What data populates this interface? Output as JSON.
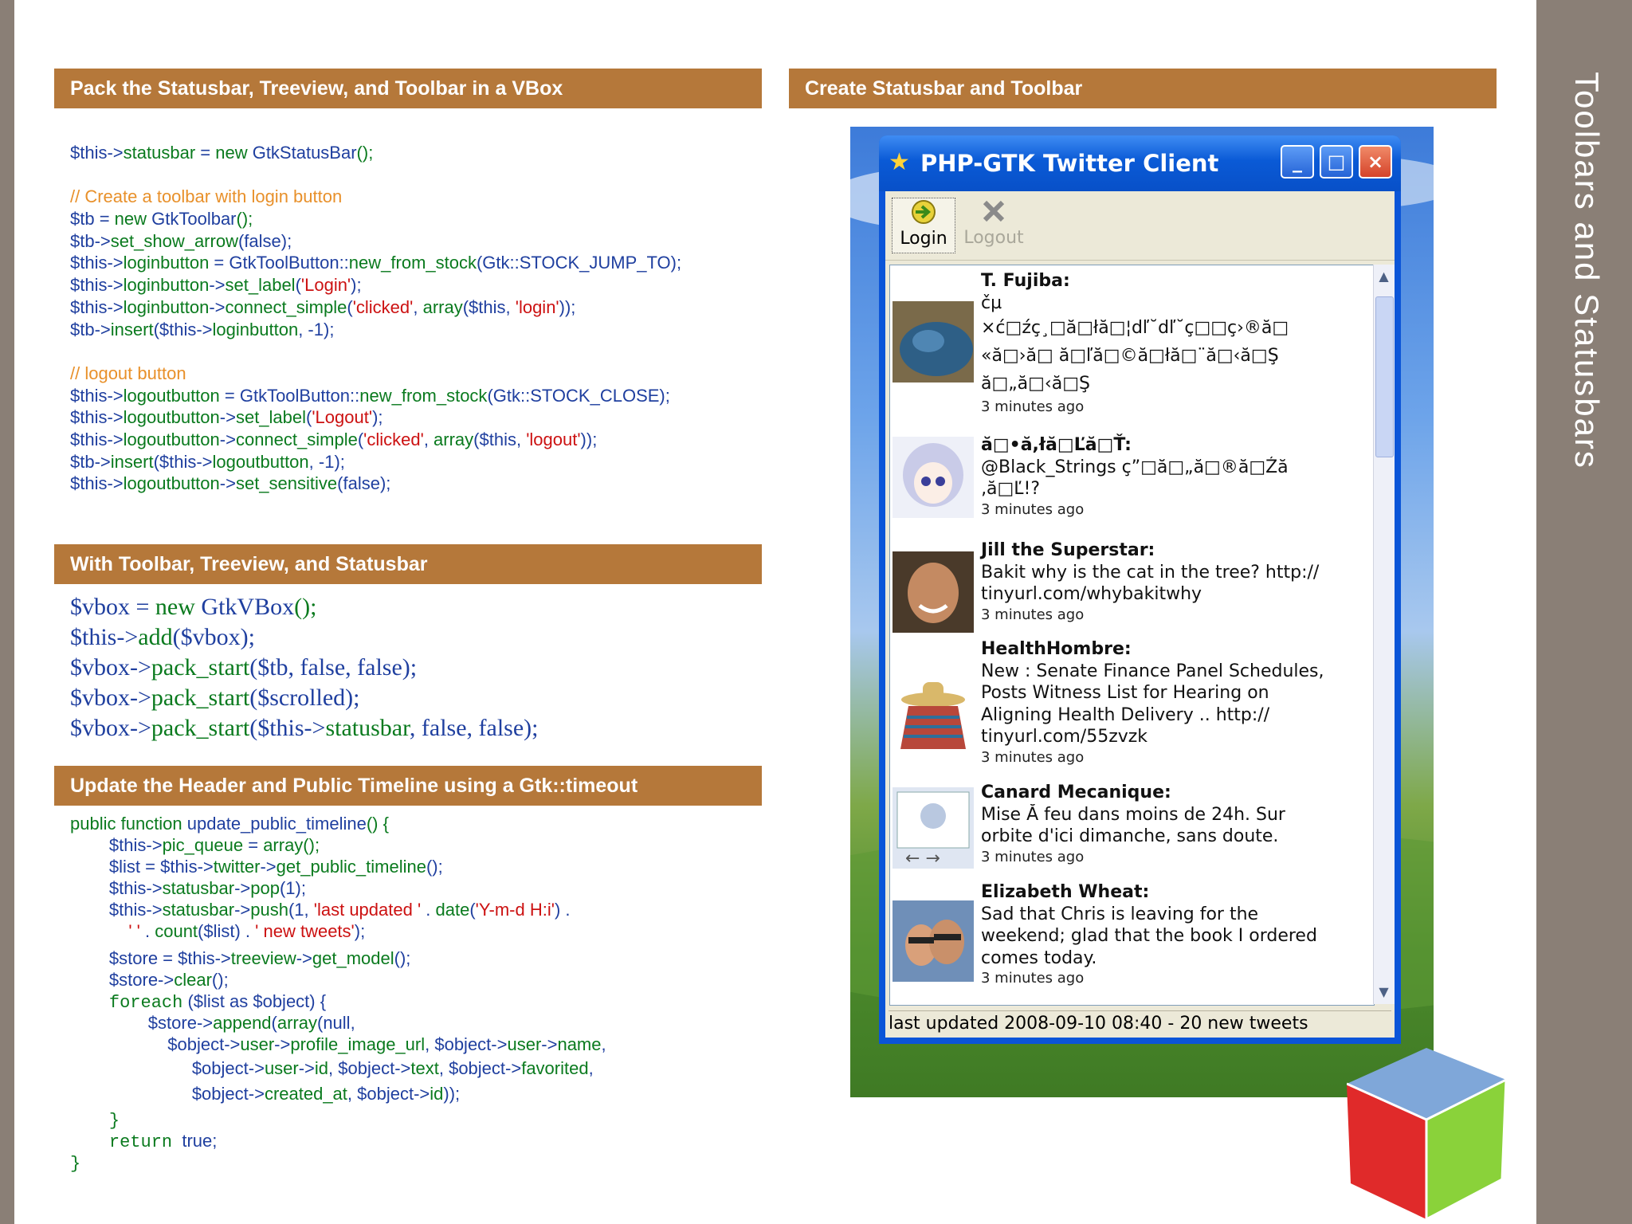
{
  "slide": {
    "title": "Toolbars and Statusbars",
    "sections": {
      "pack": "Pack the Statusbar, Treeview, and Toolbar in a VBox",
      "with": "With Toolbar, Treeview, and Statusbar",
      "update": "Update the Header and Public Timeline using a Gtk::timeout",
      "create": "Create Statusbar and Toolbar"
    }
  },
  "code1": [
    [
      [
        "v",
        "$this->"
      ],
      [
        "f",
        "statusbar"
      ],
      [
        "v",
        " = "
      ],
      [
        "f",
        "new"
      ],
      [
        "v",
        " GtkStatusBar"
      ],
      [
        "f",
        "();"
      ]
    ],
    [],
    [
      [
        "c",
        "// Create a toolbar with login button"
      ]
    ],
    [
      [
        "v",
        "$tb = "
      ],
      [
        "f",
        "new"
      ],
      [
        "v",
        " GtkToolbar"
      ],
      [
        "f",
        "();"
      ]
    ],
    [
      [
        "v",
        "$tb->"
      ],
      [
        "f",
        "set_show_arrow"
      ],
      [
        "v",
        "(false);"
      ]
    ],
    [
      [
        "v",
        "$this->"
      ],
      [
        "f",
        "loginbutton"
      ],
      [
        "v",
        " = GtkToolButton::"
      ],
      [
        "f",
        "new_from_stock"
      ],
      [
        "v",
        "(Gtk::STOCK_JUMP_TO);"
      ]
    ],
    [
      [
        "v",
        "$this->"
      ],
      [
        "f",
        "loginbutton"
      ],
      [
        "v",
        "->"
      ],
      [
        "f",
        "set_label"
      ],
      [
        "v",
        "("
      ],
      [
        "s",
        "'Login'"
      ],
      [
        "v",
        ");"
      ]
    ],
    [
      [
        "v",
        "$this->"
      ],
      [
        "f",
        "loginbutton"
      ],
      [
        "v",
        "->"
      ],
      [
        "f",
        "connect_simple"
      ],
      [
        "v",
        "("
      ],
      [
        "s",
        "'clicked'"
      ],
      [
        "v",
        ", "
      ],
      [
        "f",
        "array"
      ],
      [
        "v",
        "($this, "
      ],
      [
        "s",
        "'login'"
      ],
      [
        "v",
        "));"
      ]
    ],
    [
      [
        "v",
        "$tb->"
      ],
      [
        "f",
        "insert"
      ],
      [
        "v",
        "($this->"
      ],
      [
        "f",
        "loginbutton"
      ],
      [
        "v",
        ", -1);"
      ]
    ],
    [],
    [
      [
        "c",
        "// logout button"
      ]
    ],
    [
      [
        "v",
        "$this->"
      ],
      [
        "f",
        "logoutbutton"
      ],
      [
        "v",
        " = GtkToolButton::"
      ],
      [
        "f",
        "new_from_stock"
      ],
      [
        "v",
        "(Gtk::STOCK_CLOSE);"
      ]
    ],
    [
      [
        "v",
        "$this->"
      ],
      [
        "f",
        "logoutbutton"
      ],
      [
        "v",
        "->"
      ],
      [
        "f",
        "set_label"
      ],
      [
        "v",
        "("
      ],
      [
        "s",
        "'Logout'"
      ],
      [
        "v",
        ");"
      ]
    ],
    [
      [
        "v",
        "$this->"
      ],
      [
        "f",
        "logoutbutton"
      ],
      [
        "v",
        "->"
      ],
      [
        "f",
        "connect_simple"
      ],
      [
        "v",
        "("
      ],
      [
        "s",
        "'clicked'"
      ],
      [
        "v",
        ", "
      ],
      [
        "f",
        "array"
      ],
      [
        "v",
        "($this, "
      ],
      [
        "s",
        "'logout'"
      ],
      [
        "v",
        "));"
      ]
    ],
    [
      [
        "v",
        "$tb->"
      ],
      [
        "f",
        "insert"
      ],
      [
        "v",
        "($this->"
      ],
      [
        "f",
        "logoutbutton"
      ],
      [
        "v",
        ", -1);"
      ]
    ],
    [
      [
        "v",
        "$this->"
      ],
      [
        "f",
        "logoutbutton"
      ],
      [
        "v",
        "->"
      ],
      [
        "f",
        "set_sensitive"
      ],
      [
        "v",
        "(false);"
      ]
    ]
  ],
  "code2": [
    [
      [
        "v",
        "$vbox = "
      ],
      [
        "f",
        "new"
      ],
      [
        "v",
        " GtkVBox"
      ],
      [
        "f",
        "();"
      ]
    ],
    [
      [
        "v",
        "$this->"
      ],
      [
        "f",
        "add"
      ],
      [
        "v",
        "($vbox);"
      ]
    ],
    [
      [
        "v",
        "$vbox->"
      ],
      [
        "f",
        "pack_start"
      ],
      [
        "v",
        "($tb, false, false);"
      ]
    ],
    [
      [
        "v",
        "$vbox->"
      ],
      [
        "f",
        "pack_start"
      ],
      [
        "v",
        "($scrolled);"
      ]
    ],
    [
      [
        "v",
        "$vbox->"
      ],
      [
        "f",
        "pack_start"
      ],
      [
        "v",
        "($this->"
      ],
      [
        "f",
        "statusbar"
      ],
      [
        "v",
        ", false, false);"
      ]
    ]
  ],
  "code3": [
    [
      [
        "f",
        "public function "
      ],
      [
        "v",
        "update_public_timeline"
      ],
      [
        "f",
        "() {"
      ]
    ],
    [
      [
        "i",
        "        "
      ],
      [
        "v",
        "$this->"
      ],
      [
        "f",
        "pic_queue"
      ],
      [
        "v",
        " = "
      ],
      [
        "f",
        "array();"
      ]
    ],
    [
      [
        "i",
        "        "
      ],
      [
        "v",
        "$list = $this->"
      ],
      [
        "f",
        "twitter"
      ],
      [
        "v",
        "->"
      ],
      [
        "f",
        "get_public_timeline"
      ],
      [
        "v",
        "();"
      ]
    ],
    [
      [
        "i",
        "        "
      ],
      [
        "v",
        "$this->"
      ],
      [
        "f",
        "statusbar"
      ],
      [
        "v",
        "->"
      ],
      [
        "f",
        "pop"
      ],
      [
        "v",
        "(1);"
      ]
    ],
    [
      [
        "i",
        "        "
      ],
      [
        "v",
        "$this->"
      ],
      [
        "f",
        "statusbar"
      ],
      [
        "v",
        "->"
      ],
      [
        "f",
        "push"
      ],
      [
        "v",
        "(1, "
      ],
      [
        "s",
        "'last updated '"
      ],
      [
        "v",
        " . "
      ],
      [
        "f",
        "date"
      ],
      [
        "v",
        "("
      ],
      [
        "s",
        "'Y-m-d H:i'"
      ],
      [
        "v",
        ") ."
      ]
    ],
    [
      [
        "i",
        "            "
      ],
      [
        "s",
        "' '"
      ],
      [
        "v",
        " . "
      ],
      [
        "f",
        "count"
      ],
      [
        "v",
        "($list) . "
      ],
      [
        "s",
        "' new tweets'"
      ],
      [
        "v",
        ");"
      ]
    ],
    [
      [
        "i",
        "        "
      ],
      [
        "v",
        "$store = $this->"
      ],
      [
        "f",
        "treeview"
      ],
      [
        "v",
        "->"
      ],
      [
        "f",
        "get_model"
      ],
      [
        "v",
        "();"
      ]
    ],
    [
      [
        "i",
        "        "
      ],
      [
        "v",
        "$store->"
      ],
      [
        "f",
        "clear"
      ],
      [
        "v",
        "();"
      ]
    ],
    [
      [
        "i",
        "        "
      ],
      [
        "m",
        "foreach"
      ],
      [
        "v",
        " ($list as $object) {"
      ]
    ],
    [
      [
        "i",
        "                "
      ],
      [
        "v",
        "$store->"
      ],
      [
        "f",
        "append"
      ],
      [
        "v",
        "("
      ],
      [
        "f",
        "array"
      ],
      [
        "v",
        "(null,"
      ]
    ],
    [
      [
        "i",
        "                    "
      ],
      [
        "v",
        "$object->"
      ],
      [
        "f",
        "user"
      ],
      [
        "v",
        "->"
      ],
      [
        "f",
        "profile_image_url"
      ],
      [
        "v",
        ", $object->"
      ],
      [
        "f",
        "user"
      ],
      [
        "v",
        "->"
      ],
      [
        "f",
        "name"
      ],
      [
        "v",
        ","
      ]
    ],
    [
      [
        "i",
        "                         "
      ],
      [
        "v",
        "$object->"
      ],
      [
        "f",
        "user"
      ],
      [
        "v",
        "->"
      ],
      [
        "f",
        "id"
      ],
      [
        "v",
        ", $object->"
      ],
      [
        "f",
        "text"
      ],
      [
        "v",
        ", $object->"
      ],
      [
        "f",
        "favorited"
      ],
      [
        "v",
        ","
      ]
    ],
    [
      [
        "i",
        "                         "
      ],
      [
        "v",
        "$object->"
      ],
      [
        "f",
        "created_at"
      ],
      [
        "v",
        ", $object->"
      ],
      [
        "f",
        "id"
      ],
      [
        "v",
        "));"
      ]
    ],
    [
      [
        "i",
        "        "
      ],
      [
        "m",
        "}"
      ]
    ],
    [
      [
        "i",
        "        "
      ],
      [
        "m",
        "return"
      ],
      [
        "v",
        "  true;"
      ]
    ],
    [
      [
        "m",
        "}"
      ]
    ]
  ],
  "window": {
    "title": "PHP-GTK Twitter Client",
    "minimize": "_",
    "maximize": "□",
    "close": "×",
    "toolbar": {
      "login": "Login",
      "logout": "Logout"
    },
    "status": "last updated 2008-09-10 08:40 - 20 new tweets",
    "tweets": [
      {
        "name": "T. Fujiba:",
        "lines": [
          "čµ",
          "×ć□źç¸□ă□łă□¦dľ˘dľ˘ç□□ç›®ă□",
          "«ă□›ă□ ă□ľă□©ă□łă□¨ă□‹ă□Ş",
          "ă□„ă□‹ă□Ş"
        ],
        "ago": "3 minutes ago",
        "avatar": "blue"
      },
      {
        "name": "ă□•ă,łă□Ľă□Ť:",
        "lines": [
          "@Black_Strings ç”□ă□„ă□®ă□Źă",
          "‚ă□Ľ!?"
        ],
        "ago": "3 minutes ago",
        "avatar": "anime"
      },
      {
        "name": "Jill the Superstar:",
        "lines": [
          "Bakit why is the cat in the tree? http://",
          "tinyurl.com/whybakitwhy"
        ],
        "ago": "3 minutes ago",
        "avatar": "face"
      },
      {
        "name": "HealthHombre:",
        "lines": [
          "New : Senate Finance Panel Schedules,",
          "Posts Witness List for Hearing on",
          "Aligning Health Delivery .. http://",
          "tinyurl.com/55zvzk"
        ],
        "ago": "3 minutes ago",
        "avatar": "sombrero"
      },
      {
        "name": "Canard Mecanique:",
        "lines": [
          "Mise Ă  feu dans moins de 24h. Sur",
          "orbite d'ici dimanche, sans doute."
        ],
        "ago": "3 minutes ago",
        "avatar": "browser"
      },
      {
        "name": "Elizabeth Wheat:",
        "lines": [
          "Sad that Chris is leaving for the",
          "weekend; glad that the book I ordered",
          "comes today."
        ],
        "ago": "3 minutes ago",
        "avatar": "couple"
      }
    ]
  },
  "colors": {
    "header": "#b5783a",
    "band": "#8a7f76",
    "var": "#1f3f9f",
    "fn": "#0a7a1e",
    "str": "#cc1111",
    "comment": "#e8902a"
  }
}
